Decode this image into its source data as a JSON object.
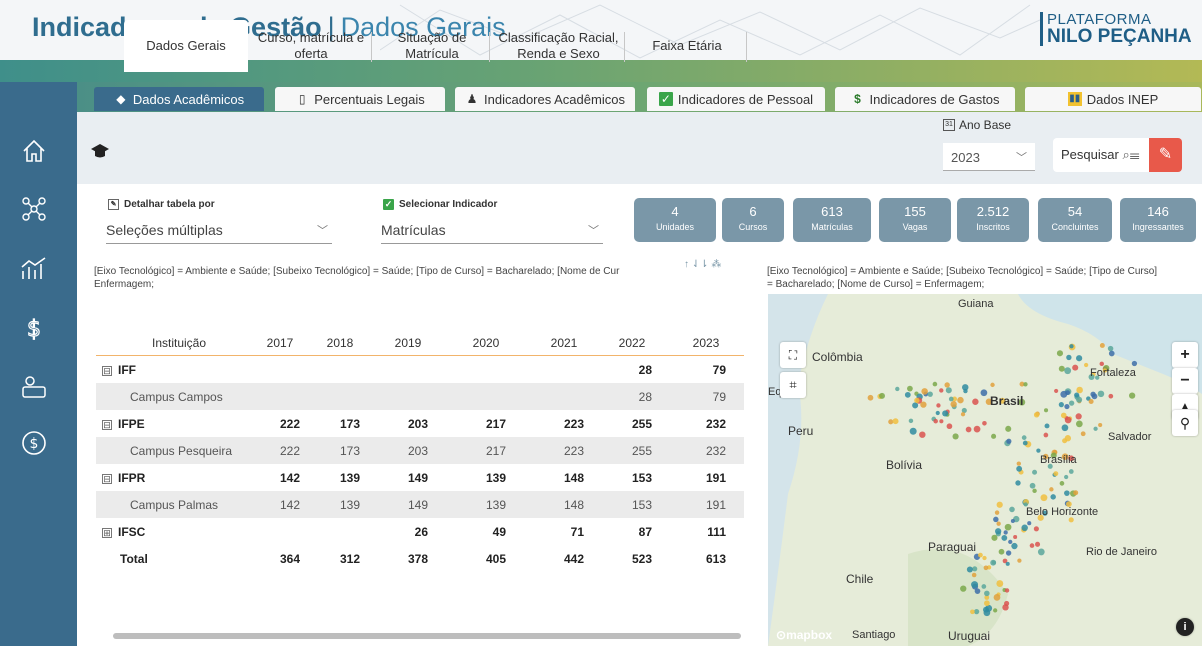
{
  "header": {
    "title_bold": "Indicadores de Gestão",
    "title_sep": "|",
    "title_sub": "Dados Gerais",
    "brand_line1": "PLATAFORMA",
    "brand_line2": "NILO PEÇANHA"
  },
  "nav_icons": [
    "home-icon",
    "network-icon",
    "chart-growth-icon",
    "dollar-icon",
    "money-hand-icon",
    "dollar-circle-icon"
  ],
  "top_tabs": [
    {
      "label": "Dados Acadêmicos",
      "icon": "graduation-cap-icon",
      "active": true
    },
    {
      "label": "Percentuais Legais",
      "icon": "document-icon",
      "active": false
    },
    {
      "label": "Indicadores Acadêmicos",
      "icon": "student-icon",
      "active": false
    },
    {
      "label": "Indicadores de Pessoal",
      "icon": "checkbox-icon",
      "active": false
    },
    {
      "label": "Indicadores de Gastos",
      "icon": "dollar-icon",
      "active": false
    },
    {
      "label": "Dados INEP",
      "icon": "bar-chart-icon",
      "active": false
    }
  ],
  "sub_tabs": [
    {
      "label": "Dados Gerais",
      "active": true
    },
    {
      "label": "Curso, matrícula e oferta",
      "active": false
    },
    {
      "label": "Situação de Matrícula",
      "active": false
    },
    {
      "label": "Classificação Racial, Renda e Sexo",
      "active": false
    },
    {
      "label": "Faixa Etária",
      "active": false
    }
  ],
  "ano_base": {
    "label": "Ano Base",
    "calendar_glyph": "31",
    "value": "2023"
  },
  "search": {
    "label": "Pesquisar"
  },
  "filters": {
    "detail_label": "Detalhar tabela por",
    "detail_value": "Seleções múltiplas",
    "indicator_label": "Selecionar Indicador",
    "indicator_value": "Matrículas"
  },
  "kpis": [
    {
      "value": "4",
      "label": "Unidades"
    },
    {
      "value": "6",
      "label": "Cursos"
    },
    {
      "value": "613",
      "label": "Matrículas"
    },
    {
      "value": "155",
      "label": "Vagas"
    },
    {
      "value": "2.512",
      "label": "Inscritos"
    },
    {
      "value": "54",
      "label": "Concluintes"
    },
    {
      "value": "146",
      "label": "Ingressantes"
    }
  ],
  "table_filter_text": "[Eixo Tecnológico] = Ambiente e Saúde; [Subeixo Tecnológico] = Saúde; [Tipo de Curso] = Bacharelado; [Nome de Cur",
  "table_filter_text2": "Enfermagem;",
  "table_icons": "↑ ⇃⇂ ⁂",
  "table": {
    "headers": [
      "Instituição",
      "2017",
      "2018",
      "2019",
      "2020",
      "2021",
      "2022",
      "2023"
    ],
    "rows": [
      {
        "type": "group",
        "expand": "⊟",
        "cells": [
          "IFF",
          "",
          "",
          "",
          "",
          "",
          "28",
          "79"
        ]
      },
      {
        "type": "child",
        "cells": [
          "Campus Campos",
          "",
          "",
          "",
          "",
          "",
          "28",
          "79"
        ]
      },
      {
        "type": "group",
        "expand": "⊟",
        "cells": [
          "IFPE",
          "222",
          "173",
          "203",
          "217",
          "223",
          "255",
          "232"
        ]
      },
      {
        "type": "child",
        "cells": [
          "Campus Pesqueira",
          "222",
          "173",
          "203",
          "217",
          "223",
          "255",
          "232"
        ]
      },
      {
        "type": "group",
        "expand": "⊟",
        "cells": [
          "IFPR",
          "142",
          "139",
          "149",
          "139",
          "148",
          "153",
          "191"
        ]
      },
      {
        "type": "child",
        "cells": [
          "Campus Palmas",
          "142",
          "139",
          "149",
          "139",
          "148",
          "153",
          "191"
        ]
      },
      {
        "type": "group",
        "expand": "⊞",
        "cells": [
          "IFSC",
          "",
          "",
          "26",
          "49",
          "71",
          "87",
          "111"
        ]
      },
      {
        "type": "total",
        "cells": [
          "Total",
          "364",
          "312",
          "378",
          "405",
          "442",
          "523",
          "613"
        ]
      }
    ]
  },
  "map_filter_text": "[Eixo Tecnológico] = Ambiente e Saúde; [Subeixo Tecnológico] = Saúde; [Tipo de Curso]",
  "map_filter_text2": "= Bacharelado; [Nome de Curso] = Enfermagem;",
  "map": {
    "labels": {
      "guiana": "Guiana",
      "colombia": "Colômbia",
      "eq": "Eq",
      "fortaleza": "Fortaleza",
      "brasil": "Brasil",
      "peru": "Peru",
      "salvador": "Salvador",
      "bolivia": "Bolívia",
      "brasilia": "Brasília",
      "belo": "Belo Horizonte",
      "paraguai": "Paraguai",
      "rio": "Rio de Janeiro",
      "chile": "Chile",
      "santiago": "Santiago",
      "uruguai": "Uruguai"
    },
    "attribution": "mapbox",
    "controls": {
      "zoom_in": "+",
      "zoom_out": "−",
      "reset": "▲",
      "locate": "⚲",
      "info": "i",
      "lasso": "⛶",
      "select": "⌗"
    }
  }
}
